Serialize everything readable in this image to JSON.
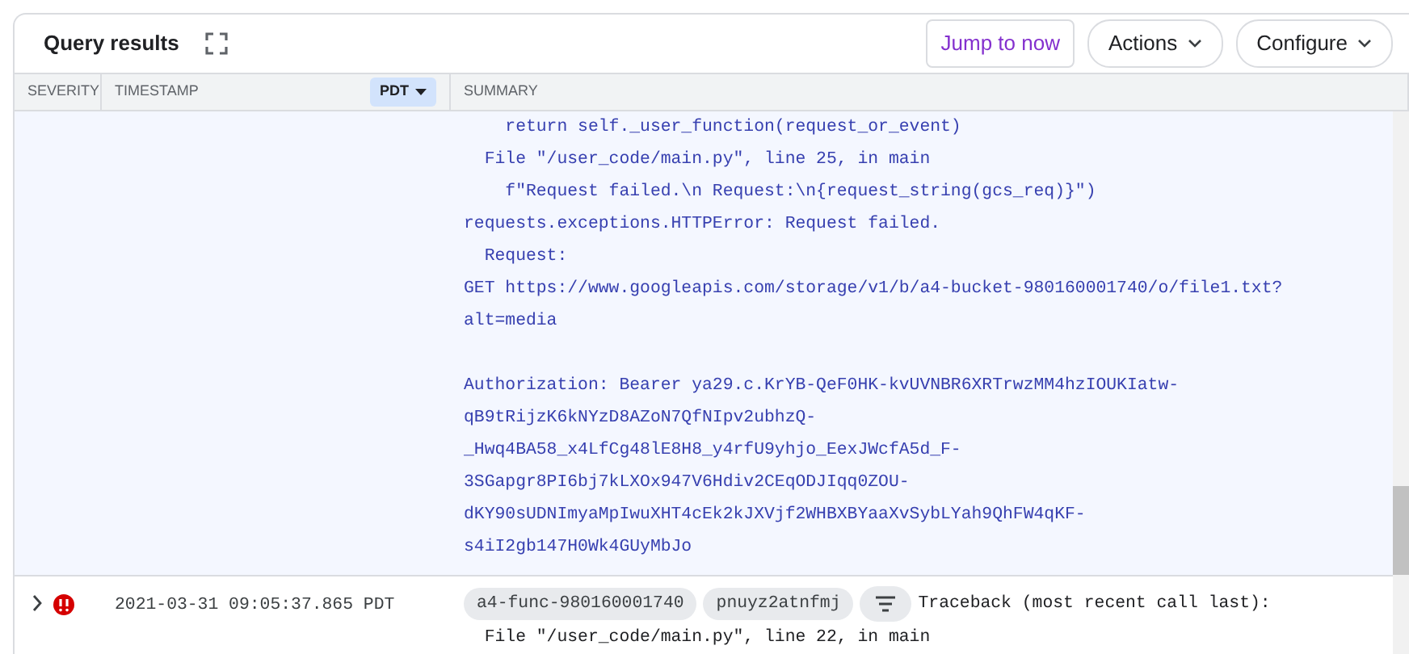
{
  "header": {
    "title": "Query results",
    "buttons": [
      {
        "label": "Jump to now",
        "kind": "outline"
      },
      {
        "label": "Actions",
        "kind": "menu"
      },
      {
        "label": "Configure",
        "kind": "menu"
      }
    ]
  },
  "columns": [
    {
      "label": "SEVERITY"
    },
    {
      "label": "TIMESTAMP",
      "zone": "PDT"
    },
    {
      "label": "SUMMARY"
    }
  ],
  "expanded_entry": {
    "blocks": [
      [
        "    return self._user_function(request_or_event)",
        "  File \"/user_code/main.py\", line 25, in main",
        "    f\"Request failed.\\n Request:\\n{request_string(gcs_req)}\")",
        "requests.exceptions.HTTPError: Request failed.",
        "  Request:",
        "GET https://www.googleapis.com/storage/v1/b/a4-bucket-980160001740/o/file1.txt?",
        "alt=media"
      ],
      [
        "Authorization: Bearer ya29.c.KrYB-QeF0HK-kvUVNBR6XRTrwzMM4hzIOUKIatw-",
        "qB9tRijzK6kNYzD8AZoN7QfNIpv2ubhzQ-",
        "_Hwq4BA58_x4LfCg48lE8H8_y4rfU9yhjo_EexJWcfA5d_F-",
        "3SGapgr8PI6bj7kLXOx947V6Hdiv2CEqODJIqq0ZOU-",
        "dKY90sUDNImyaMpIwuXHT4cEk2kJXVjf2WHBXBYaaXvSybLYah9QhFW4qKF-",
        "s4iI2gb147H0Wk4GUyMbJo"
      ]
    ]
  },
  "rows": [
    {
      "expanded": false,
      "kind": "error",
      "timestamp": "2021-03-31 09:05:37.865 PDT",
      "chips": [
        "a4-func-980160001740",
        "pnuyz2atnfmj"
      ],
      "summary": [
        "Traceback (most recent call last):",
        "  File \"/user_code/main.py\", line 22, in main"
      ]
    }
  ]
}
